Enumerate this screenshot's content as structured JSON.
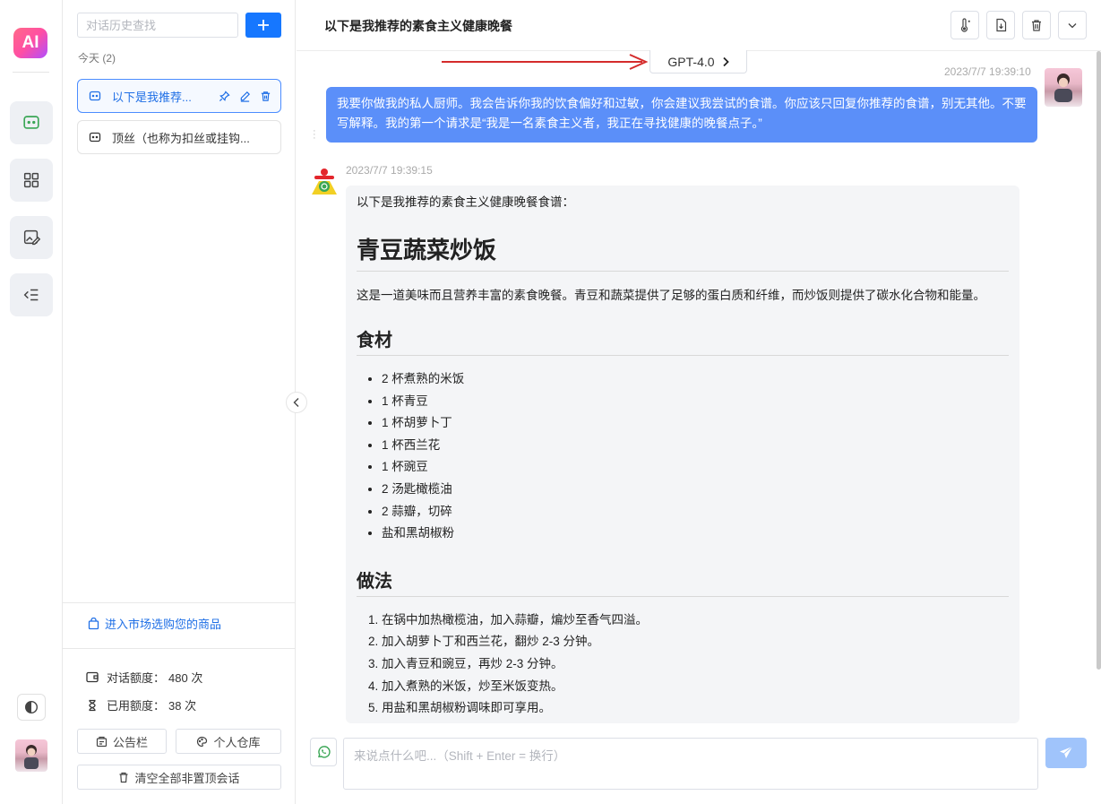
{
  "app": {
    "logo_text": "AI",
    "brand_color": "#1677ff"
  },
  "rail": {
    "items": [
      {
        "name": "chat",
        "icon": "chat-bubble-icon"
      },
      {
        "name": "apps",
        "icon": "grid-icon"
      },
      {
        "name": "draw",
        "icon": "image-edit-icon"
      },
      {
        "name": "menu",
        "icon": "list-collapse-icon"
      }
    ],
    "theme_icon": "contrast-icon"
  },
  "history": {
    "search_placeholder": "对话历史查找",
    "group_label": "今天 (2)",
    "items": [
      {
        "title": "以下是我推荐...",
        "active": true
      },
      {
        "title": "顶丝（也称为扣丝或挂钩...",
        "active": false
      }
    ],
    "market_link": "进入市场选购您的商品",
    "quota_label": "对话额度：",
    "quota_value": "480 次",
    "used_label": "已用额度：",
    "used_value": "38 次",
    "bulletin_label": "公告栏",
    "warehouse_label": "个人仓库",
    "clear_label": "清空全部非置顶会话"
  },
  "main": {
    "title": "以下是我推荐的素食主义健康晚餐",
    "model": "GPT-4.0",
    "user_time": "2023/7/7 19:39:10",
    "user_message": "我要你做我的私人厨师。我会告诉你我的饮食偏好和过敏，你会建议我尝试的食谱。你应该只回复你推荐的食谱，别无其他。不要写解释。我的第一个请求是“我是一名素食主义者，我正在寻找健康的晚餐点子。”",
    "bot_time": "2023/7/7 19:39:15",
    "answer": {
      "intro": "以下是我推荐的素食主义健康晚餐食谱：",
      "h1": "青豆蔬菜炒饭",
      "desc": "这是一道美味而且营养丰富的素食晚餐。青豆和蔬菜提供了足够的蛋白质和纤维，而炒饭则提供了碳水化合物和能量。",
      "ingredients_title": "食材",
      "ingredients": [
        "2 杯煮熟的米饭",
        "1 杯青豆",
        "1 杯胡萝卜丁",
        "1 杯西兰花",
        "1 杯豌豆",
        "2 汤匙橄榄油",
        "2 蒜瓣，切碎",
        "盐和黑胡椒粉"
      ],
      "method_title": "做法",
      "steps": [
        "在锅中加热橄榄油，加入蒜瓣，煸炒至香气四溢。",
        "加入胡萝卜丁和西兰花，翻炒 2-3 分钟。",
        "加入青豆和豌豆，再炒 2-3 分钟。",
        "加入煮熟的米饭，炒至米饭变热。",
        "用盐和黑胡椒粉调味即可享用。"
      ]
    },
    "input_placeholder": "来说点什么吧...（Shift + Enter = 换行）"
  }
}
